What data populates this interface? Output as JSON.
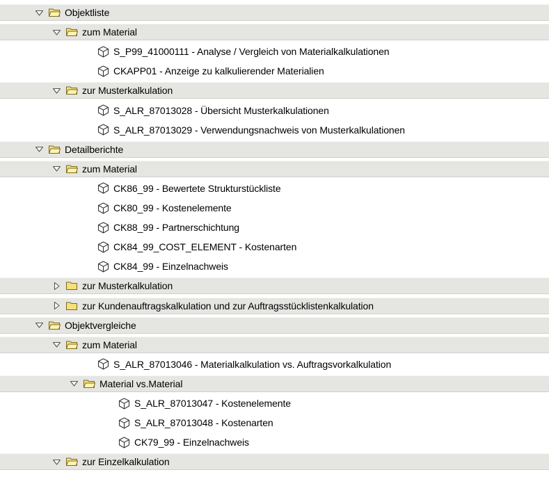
{
  "tree": [
    {
      "type": "folder",
      "level": 0,
      "expanded": true,
      "label": "Objektliste"
    },
    {
      "type": "folder",
      "level": 1,
      "expanded": true,
      "label": "zum Material"
    },
    {
      "type": "report",
      "level": 2,
      "label": "S_P99_41000111 - Analyse / Vergleich von Materialkalkulationen"
    },
    {
      "type": "report",
      "level": 2,
      "label": "CKAPP01 - Anzeige zu kalkulierender Materialien"
    },
    {
      "type": "folder",
      "level": 1,
      "expanded": true,
      "label": "zur Musterkalkulation"
    },
    {
      "type": "report",
      "level": 2,
      "label": "S_ALR_87013028 - Übersicht Musterkalkulationen"
    },
    {
      "type": "report",
      "level": 2,
      "label": "S_ALR_87013029 - Verwendungsnachweis von Musterkalkulationen"
    },
    {
      "type": "folder",
      "level": 0,
      "expanded": true,
      "label": "Detailberichte"
    },
    {
      "type": "folder",
      "level": 1,
      "expanded": true,
      "label": "zum Material"
    },
    {
      "type": "report",
      "level": 2,
      "label": "CK86_99 - Bewertete Strukturstückliste"
    },
    {
      "type": "report",
      "level": 2,
      "label": "CK80_99 - Kostenelemente"
    },
    {
      "type": "report",
      "level": 2,
      "label": "CK88_99 - Partnerschichtung"
    },
    {
      "type": "report",
      "level": 2,
      "label": "CK84_99_COST_ELEMENT - Kostenarten"
    },
    {
      "type": "report",
      "level": 2,
      "label": "CK84_99 - Einzelnachweis"
    },
    {
      "type": "folder",
      "level": 1,
      "expanded": false,
      "label": "zur Musterkalkulation"
    },
    {
      "type": "folder",
      "level": 1,
      "expanded": false,
      "label": "zur Kundenauftragskalkulation und zur Auftragsstücklistenkalkulation"
    },
    {
      "type": "folder",
      "level": 0,
      "expanded": true,
      "label": "Objektvergleiche"
    },
    {
      "type": "folder",
      "level": 1,
      "expanded": true,
      "label": "zum Material"
    },
    {
      "type": "report",
      "level": 2,
      "label": "S_ALR_87013046 - Materialkalkulation vs. Auftragsvorkalkulation"
    },
    {
      "type": "folder",
      "level": 2,
      "expanded": true,
      "label": "Material vs.Material"
    },
    {
      "type": "report",
      "level": 3,
      "label": "S_ALR_87013047 - Kostenelemente"
    },
    {
      "type": "report",
      "level": 3,
      "label": "S_ALR_87013048 - Kostenarten"
    },
    {
      "type": "report",
      "level": 3,
      "label": "CK79_99 - Einzelnachweis"
    },
    {
      "type": "folder",
      "level": 1,
      "expanded": true,
      "label": "zur Einzelkalkulation"
    }
  ],
  "colors": {
    "folder_row_bg": "#e5e5e2",
    "folder_fill": "#f5e07a",
    "folder_stroke": "#7a6a22",
    "toggle_stroke": "#555555",
    "cube_stroke": "#333333"
  }
}
